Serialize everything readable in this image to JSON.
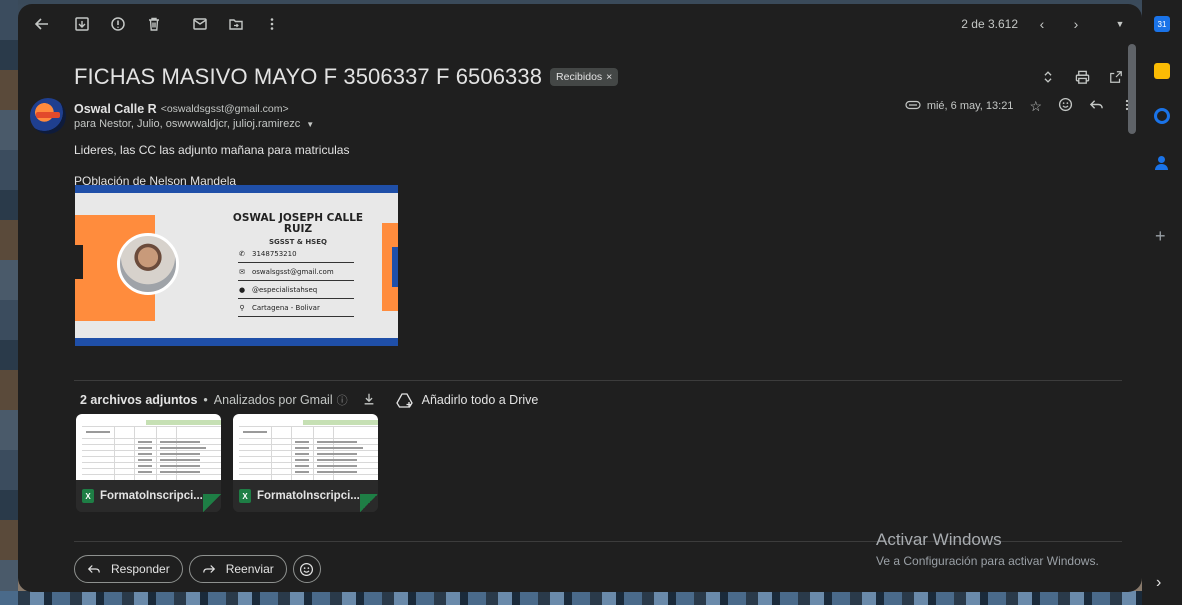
{
  "toolbar": {
    "counter": "2 de 3.612",
    "icons": [
      "back-arrow-icon",
      "archive-icon",
      "report-spam-icon",
      "delete-icon",
      "mark-unread-icon",
      "move-to-icon",
      "more-vert-icon"
    ]
  },
  "email": {
    "subject": "FICHAS MASIVO MAYO F 3506337 F 6506338",
    "label": "Recibidos",
    "label_close": "×",
    "sender_name": "Oswal Calle R",
    "sender_email": "<oswaldsgsst@gmail.com>",
    "recipients": "para Nestor, Julio, oswwwaldjcr, julioj.ramirezc",
    "date": "mié, 6 may, 13:21",
    "body_line1": "Lideres, las CC las adjunto mañana para matriculas",
    "body_line2": "POblación de Nelson Mandela"
  },
  "card": {
    "name_line1": "OSWAL JOSEPH CALLE",
    "name_line2": "RUIZ",
    "role": "SGSST & HSEQ",
    "phone": "3148753210",
    "email": "oswalsgsst@gmail.com",
    "handle": "@especialistahseq",
    "location": "Cartagena - Bolivar"
  },
  "attachments": {
    "count_label": "2 archivos adjuntos",
    "scanned_label": "Analizados por Gmail",
    "drive_label": "Añadirlo todo a Drive",
    "files": [
      {
        "name": "FormatoInscripci..."
      },
      {
        "name": "FormatoInscripci..."
      }
    ]
  },
  "actions": {
    "reply": "Responder",
    "forward": "Reenviar"
  },
  "watermark": {
    "title": "Activar Windows",
    "subtitle": "Ve a Configuración para activar Windows."
  },
  "colors": {
    "background": "#1f1f1f",
    "card_orange": "#ff8c3d",
    "card_blue": "#1f4fa8",
    "excel_green": "#1e7e45"
  }
}
